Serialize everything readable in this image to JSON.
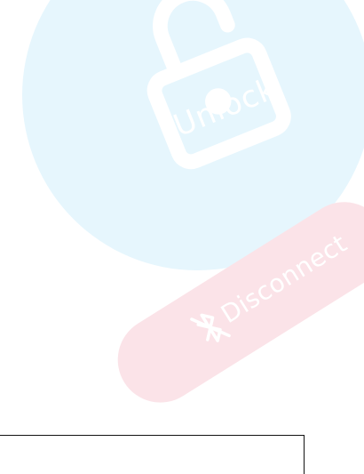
{
  "unlock": {
    "label": "Unlock",
    "icon": "unlock-padlock-icon",
    "color": "#e6f6fd"
  },
  "disconnect": {
    "label": "Disconnect",
    "icon": "bluetooth-disabled-icon",
    "color": "#fbe3e8"
  },
  "bottom_box": {
    "value": ""
  }
}
